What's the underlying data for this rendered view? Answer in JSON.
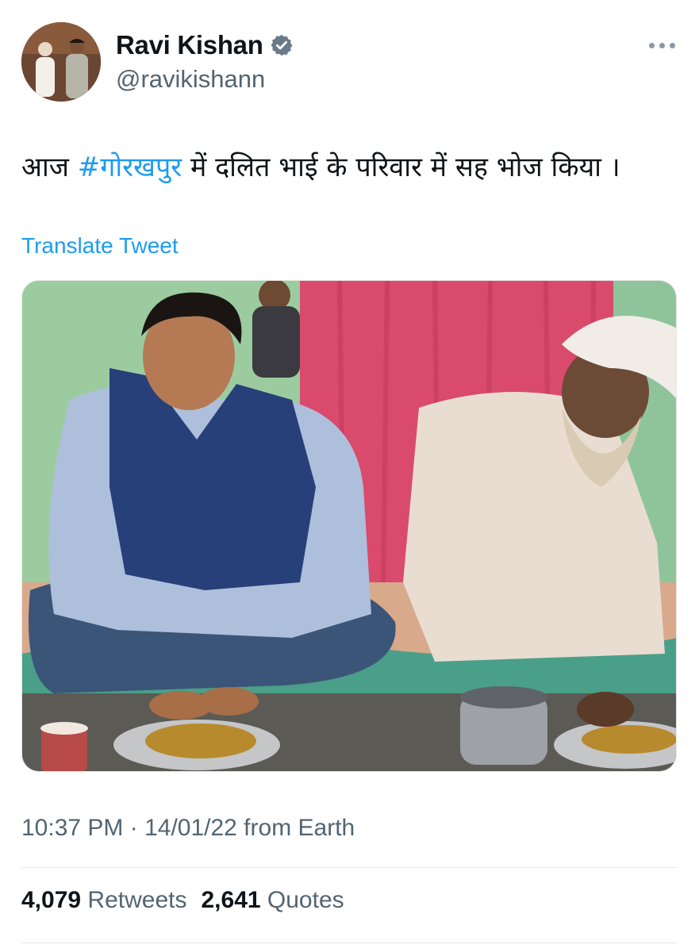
{
  "author": {
    "display_name": "Ravi Kishan",
    "handle": "@ravikishann",
    "verified": true
  },
  "tweet": {
    "text_before": "आज ",
    "hashtag": "#गोरखपुर",
    "text_after": " में दलित भाई के परिवार में सह भोज किया ।",
    "translate_label": "Translate Tweet",
    "timestamp": "10:37 PM · 14/01/22 from Earth"
  },
  "stats": {
    "retweets_count": "4,079",
    "retweets_label": "Retweets",
    "quotes_count": "2,641",
    "quotes_label": "Quotes"
  },
  "icons": {
    "verified": "verified-badge-icon",
    "more": "more-options-icon"
  },
  "colors": {
    "link": "#1d9bf0",
    "secondary_text": "#536471",
    "primary_text": "#0f1419"
  }
}
